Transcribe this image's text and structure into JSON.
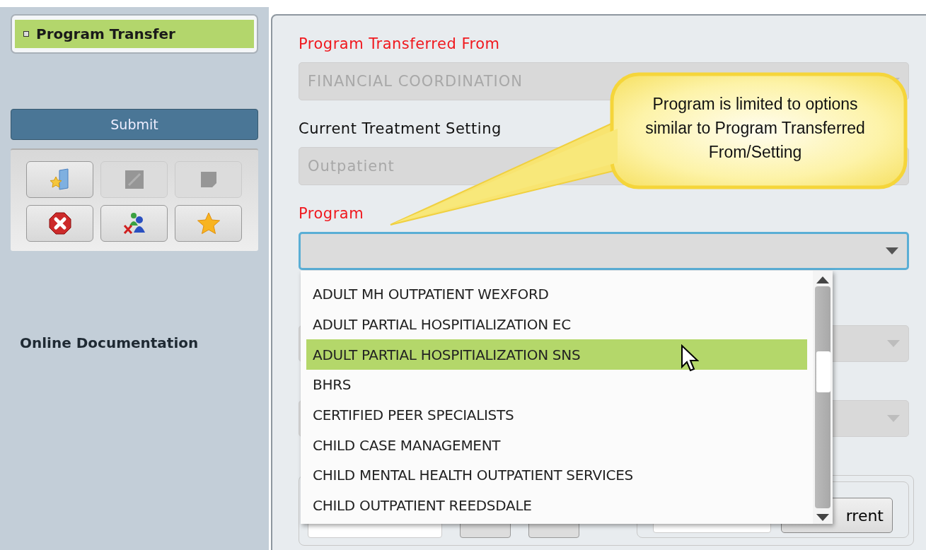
{
  "sidebar": {
    "nav_items": [
      {
        "label": "Program Transfer",
        "selected": true
      }
    ],
    "submit_button": "Submit",
    "toolbar_buttons": [
      {
        "kind": "add-folder",
        "disabled": false
      },
      {
        "kind": "edit",
        "disabled": true
      },
      {
        "kind": "note",
        "disabled": true
      },
      {
        "kind": "delete",
        "disabled": false
      },
      {
        "kind": "remove-users",
        "disabled": false
      },
      {
        "kind": "favorite",
        "disabled": false
      }
    ],
    "link": "Online Documentation"
  },
  "form": {
    "fields": [
      {
        "label": "Program Transferred From",
        "required": true,
        "value": "FINANCIAL COORDINATION",
        "disabled": true,
        "focused": false
      },
      {
        "label": "Current Treatment Setting",
        "required": false,
        "value": "Outpatient",
        "disabled": true,
        "focused": false
      },
      {
        "label": "Program",
        "required": true,
        "disabled": false,
        "focused": true
      }
    ],
    "dropdown_options": [
      {
        "label": "ADULT MH OUTPATIENT WEXFORD",
        "selected": false
      },
      {
        "label": "ADULT PARTIAL HOSPITIALIZATION EC",
        "selected": false
      },
      {
        "label": "ADULT PARTIAL HOSPITIALIZATION SNS",
        "selected": true
      },
      {
        "label": "BHRS",
        "selected": false
      },
      {
        "label": "CERTIFIED PEER SPECIALISTS",
        "selected": false
      },
      {
        "label": "CHILD CASE MANAGEMENT",
        "selected": false
      },
      {
        "label": "CHILD MENTAL HEALTH OUTPATIENT SERVICES",
        "selected": false
      },
      {
        "label": "CHILD OUTPATIENT REEDSDALE",
        "selected": false
      }
    ],
    "partial_button": "rrent"
  },
  "callout": {
    "text": "Program is limited to options similar to Program Transferred From/Setting"
  }
}
